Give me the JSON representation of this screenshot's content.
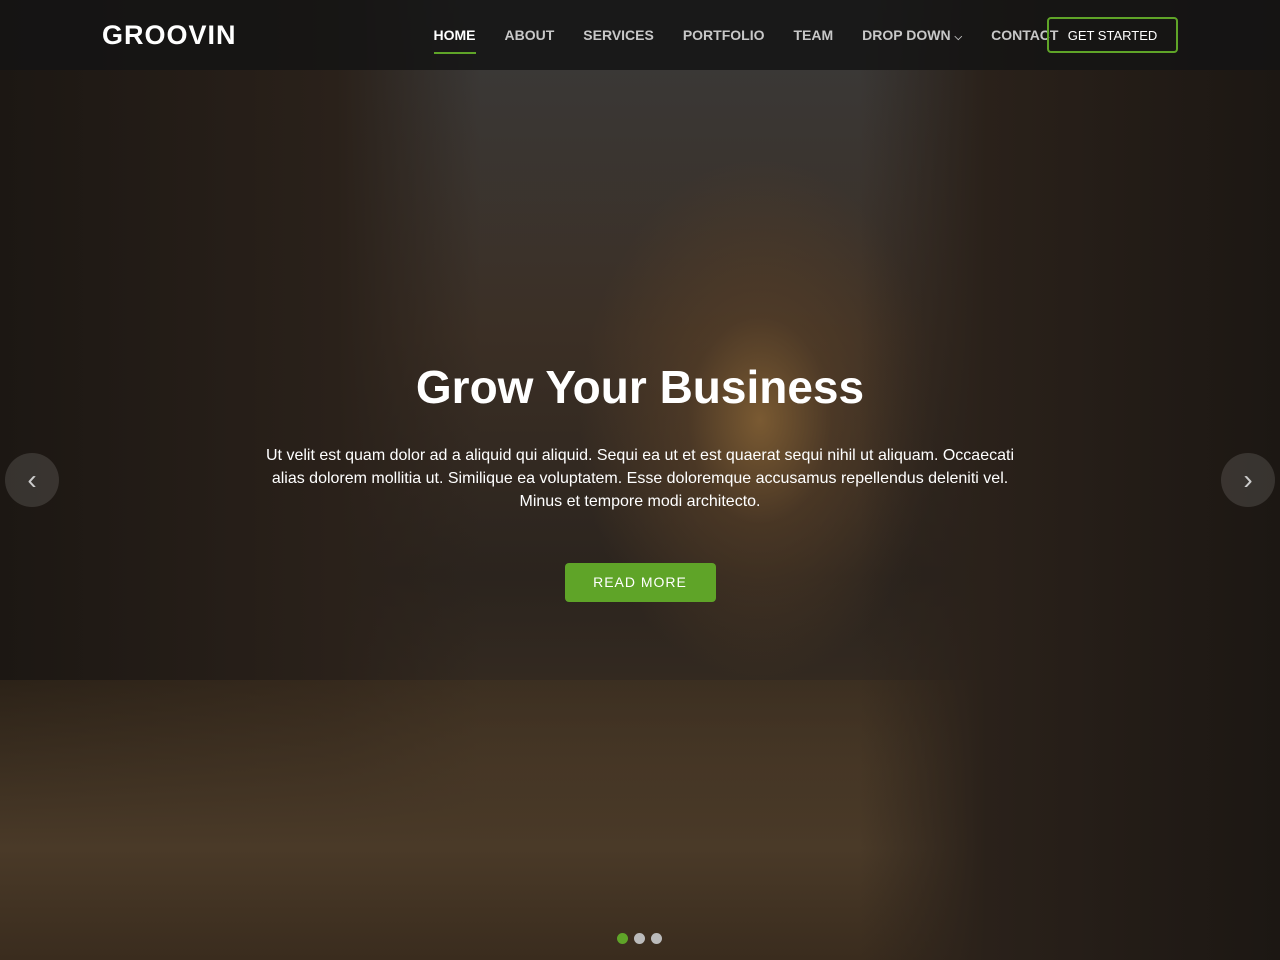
{
  "brand": "GROOVIN",
  "nav": [
    {
      "label": "HOME",
      "active": true
    },
    {
      "label": "ABOUT"
    },
    {
      "label": "SERVICES"
    },
    {
      "label": "PORTFOLIO"
    },
    {
      "label": "TEAM"
    },
    {
      "label": "DROP DOWN",
      "icon": "chevron-down-icon"
    },
    {
      "label": "CONTACT"
    }
  ],
  "cta": "GET STARTED",
  "hero": {
    "title": "Grow Your Business",
    "text": "Ut velit est quam dolor ad a aliquid qui aliquid. Sequi ea ut et est quaerat sequi nihil ut aliquam. Occaecati alias dolorem mollitia ut. Similique ea voluptatem. Esse doloremque accusamus repellendus deleniti vel. Minus et tempore modi architecto.",
    "button": "READ MORE",
    "prev": "‹",
    "next": "›",
    "active_slide": 1,
    "slide_count": 3
  },
  "colors": {
    "accent": "#5fa428"
  }
}
